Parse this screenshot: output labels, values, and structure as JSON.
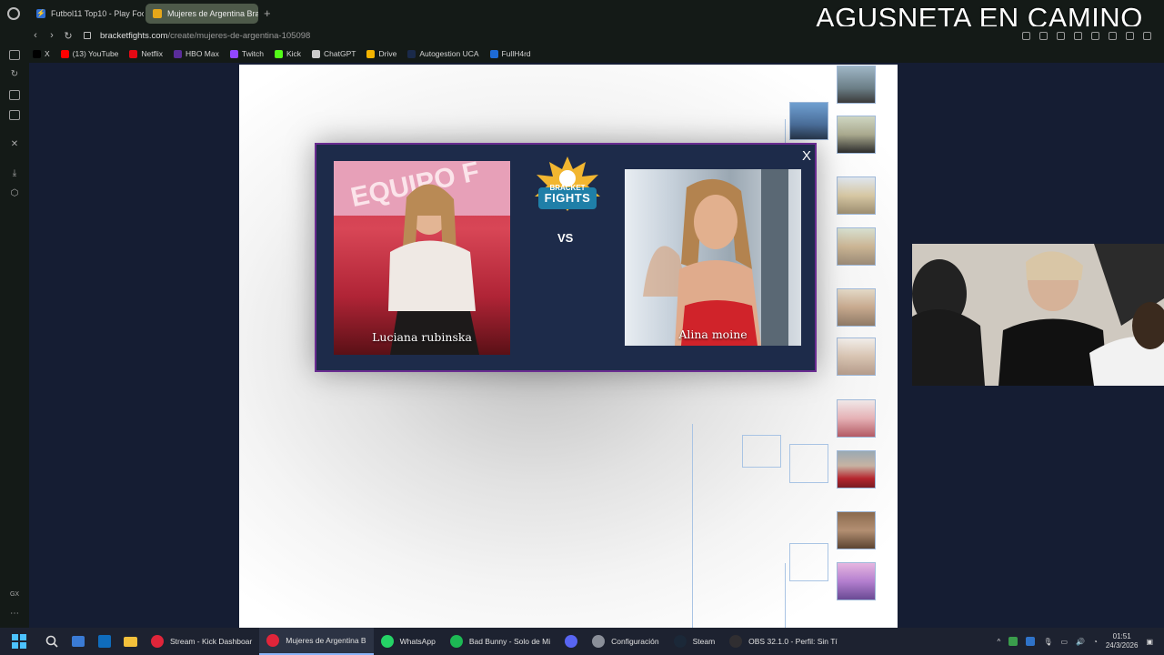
{
  "browser": {
    "tabs": [
      {
        "label": "Futbol11 Top10 - Play Foot",
        "active": false
      },
      {
        "label": "Mujeres de Argentina Brac",
        "active": true
      }
    ],
    "url_domain": "bracketfights.com",
    "url_path": "/create/mujeres-de-argentina-105098",
    "bookmarks": [
      {
        "label": "X",
        "icon": "x-icon",
        "color": "#000000"
      },
      {
        "label": "(13) YouTube",
        "icon": "youtube-icon",
        "color": "#ff0000"
      },
      {
        "label": "Netflix",
        "icon": "netflix-icon",
        "color": "#e50914"
      },
      {
        "label": "HBO Max",
        "icon": "hbo-icon",
        "color": "#5a2d9a"
      },
      {
        "label": "Twitch",
        "icon": "twitch-icon",
        "color": "#9146ff"
      },
      {
        "label": "Kick",
        "icon": "kick-icon",
        "color": "#53fc18"
      },
      {
        "label": "ChatGPT",
        "icon": "chatgpt-icon",
        "color": "#cccccc"
      },
      {
        "label": "Drive",
        "icon": "drive-icon",
        "color": "#f4b400"
      },
      {
        "label": "Autogestion UCA",
        "icon": "uca-icon",
        "color": "#1a2a4a"
      },
      {
        "label": "FullH4rd",
        "icon": "fullh4rd-icon",
        "color": "#1e6bd6"
      }
    ]
  },
  "stream_overlay": {
    "title": "AGUSNETA EN CAMINO"
  },
  "matchup": {
    "left": {
      "name": "Luciana rubinska"
    },
    "right": {
      "name": "Alina moine"
    },
    "vs_label": "VS",
    "close_label": "X",
    "logo_top": "BRACKET",
    "logo_bottom": "FIGHTS"
  },
  "sidebar": {
    "bottom_label": "GX"
  },
  "taskbar": {
    "apps": [
      {
        "label": "Stream - Kick Dashboar",
        "icon": "opera-gx-icon",
        "color": "#e0253a",
        "active": false
      },
      {
        "label": "Mujeres de Argentina B",
        "icon": "opera-gx-icon",
        "color": "#e0253a",
        "active": true
      },
      {
        "label": "WhatsApp",
        "icon": "whatsapp-icon",
        "color": "#25d366",
        "active": false
      },
      {
        "label": "Bad Bunny - Solo de Mi",
        "icon": "spotify-icon",
        "color": "#1db954",
        "active": false
      },
      {
        "label": "",
        "icon": "discord-icon",
        "color": "#5865f2",
        "active": false
      },
      {
        "label": "Configuración",
        "icon": "settings-icon",
        "color": "#8a8f99",
        "active": false
      },
      {
        "label": "Steam",
        "icon": "steam-icon",
        "color": "#1b2838",
        "active": false
      },
      {
        "label": "OBS 32.1.0 - Perfil: Sin Tí",
        "icon": "obs-icon",
        "color": "#302e31",
        "active": false
      }
    ],
    "time": "01:51",
    "date": "24/3/2026"
  },
  "colors": {
    "page_background": "#151d33",
    "modal_background": "#1d2b4a",
    "modal_border": "#6a2c91",
    "bracket_line": "#a9c4e4",
    "chrome": "#141a17"
  }
}
